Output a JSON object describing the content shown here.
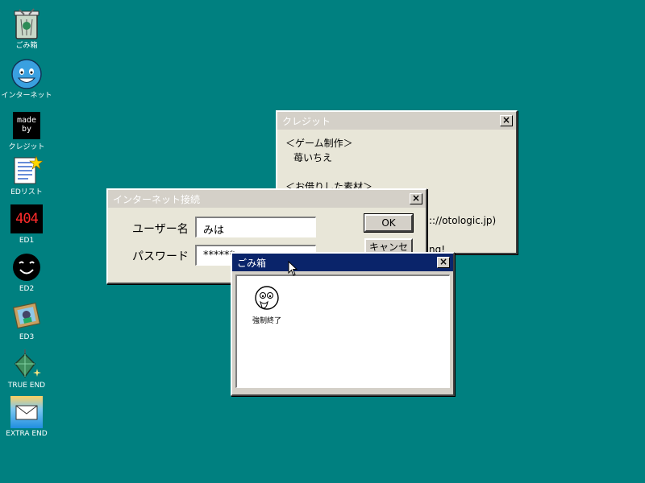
{
  "desktop": {
    "icons": [
      {
        "label": "ごみ箱",
        "icon": "trash-bin-icon"
      },
      {
        "label": "インターネット",
        "icon": "internet-smiley-icon"
      },
      {
        "label": "クレジット",
        "icon": "made-by-icon",
        "text": "made by"
      },
      {
        "label": "EDリスト",
        "icon": "document-star-icon"
      },
      {
        "label": "ED1",
        "icon": "error-404-icon",
        "text": "404"
      },
      {
        "label": "ED2",
        "icon": "black-smiley-icon"
      },
      {
        "label": "ED3",
        "icon": "picture-frame-icon"
      },
      {
        "label": "TRUE END",
        "icon": "green-gem-icon"
      },
      {
        "label": "EXTRA END",
        "icon": "envelope-icon"
      }
    ]
  },
  "credit_window": {
    "title": "クレジット",
    "close": "×",
    "lines": [
      "＜ゲーム制作＞",
      "苺いちえ",
      "",
      "＜お借りした素材＞",
      ":://otologic.jp)",
      "",
      "ng!"
    ]
  },
  "net_window": {
    "title": "インターネット接続",
    "close": "×",
    "username_label": "ユーザー名",
    "username_value": "みは",
    "password_label": "パスワード",
    "password_value": "******",
    "ok_label": "OK",
    "cancel_label": "キャンセル"
  },
  "trash_window": {
    "title": "ごみ箱",
    "close": "×",
    "items": [
      {
        "label": "強制終了",
        "icon": "ghost-face-icon"
      }
    ]
  },
  "colors": {
    "desktop": "#008080",
    "active_title": "#0a246a",
    "window_face": "#d4d0c8"
  }
}
